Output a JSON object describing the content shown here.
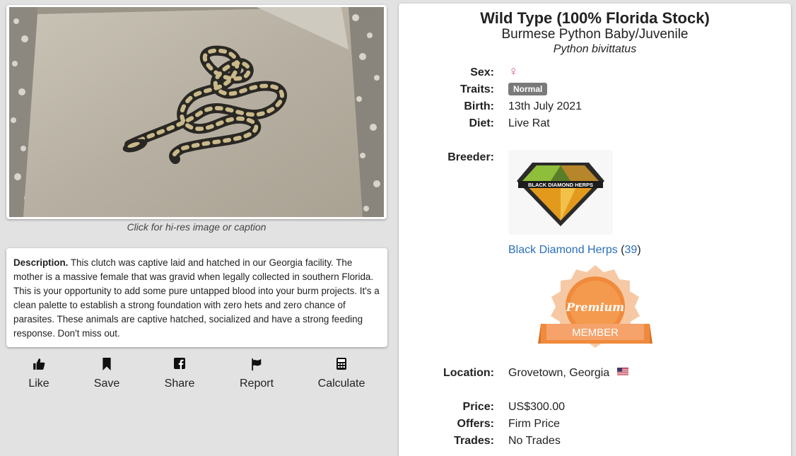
{
  "photo": {
    "caption": "Click for hi-res image or caption"
  },
  "description": {
    "label": "Description.",
    "text": "This clutch was captive laid and hatched in our Georgia facility. The mother is a massive female that was gravid when legally collected in southern Florida. This is your opportunity to add some pure untapped blood into your burm projects. It's a clean palette to establish a strong foundation with zero hets and zero chance of parasites. These animals are captive hatched, socialized and have a strong feeding response. Don't miss out."
  },
  "actions": {
    "like": "Like",
    "save": "Save",
    "share": "Share",
    "report": "Report",
    "calculate": "Calculate"
  },
  "listing": {
    "title": "Wild Type (100% Florida Stock)",
    "subtitle": "Burmese Python Baby/Juvenile",
    "latin": "Python bivittatus"
  },
  "details": {
    "sex_label": "Sex:",
    "sex_symbol": "♀",
    "traits_label": "Traits:",
    "traits_badge": "Normal",
    "birth_label": "Birth:",
    "birth_value": "13th July 2021",
    "diet_label": "Diet:",
    "diet_value": "Live Rat",
    "breeder_label": "Breeder:",
    "breeder_logo_text": "BLACK DIAMOND HERPS",
    "breeder_name": "Black Diamond Herps",
    "breeder_count": "39",
    "premium_top": "Premium",
    "premium_bottom": "MEMBER",
    "location_label": "Location:",
    "location_value": "Grovetown, Georgia",
    "price_label": "Price:",
    "price_value": "US$300.00",
    "offers_label": "Offers:",
    "offers_value": "Firm Price",
    "trades_label": "Trades:",
    "trades_value": "No Trades"
  },
  "colors": {
    "sex_female": "#e0559a",
    "link": "#2a6ebb",
    "badge": "#7a7a7a",
    "premium_orange": "#f08a3c"
  }
}
